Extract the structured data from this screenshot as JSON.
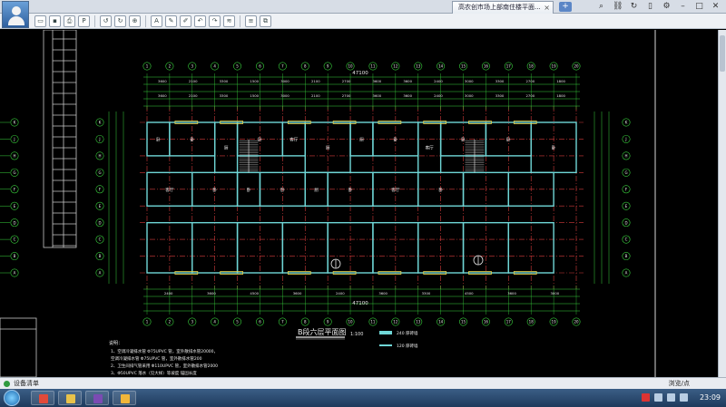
{
  "window": {
    "tab_title": "高农创市场上部南住楼平面...",
    "tab_close": "×",
    "tab_add": "+"
  },
  "toolbar": {
    "icons": [
      "open-icon",
      "save-icon",
      "print-icon",
      "pdf-icon",
      "refresh-icon",
      "rotate-icon",
      "zoom-icon",
      "text-icon",
      "pen-icon",
      "draw-icon",
      "undo-icon",
      "redo-icon",
      "measure-icon",
      "layers-icon",
      "compare-icon"
    ]
  },
  "drawing": {
    "sheet_title": "B段六层平面图",
    "scale": "1:100",
    "total_width_label": "47100",
    "legend": [
      {
        "label": "240 厚砖墙"
      },
      {
        "label": "120 厚砖墙"
      }
    ],
    "notes_title": "说明：",
    "notes": [
      "1、空调冷凝排水管 Φ75UPVC   管，室外散排水管20000，",
      "   空调冷凝排水管 Φ75UPVC   管，室外散排水管200",
      "2、卫生间排气管采用 Φ110UPVC 管，室外散排水管2000",
      "3、Φ50UPVC  落水（见大样）等坡度  锚固长度"
    ],
    "grid_top": [
      "1",
      "2",
      "3",
      "4",
      "5",
      "6",
      "7",
      "8",
      "9",
      "10",
      "11",
      "12",
      "13",
      "14",
      "15",
      "16",
      "17",
      "18",
      "19",
      "20"
    ],
    "grid_left": [
      "K",
      "J",
      "H",
      "G",
      "F",
      "E",
      "D",
      "C",
      "B",
      "A"
    ],
    "dims_top": [
      "3600",
      "2100",
      "3300",
      "1500",
      "3000",
      "2100",
      "2700",
      "3600",
      "3600",
      "2400",
      "3000",
      "3300",
      "2700",
      "1800"
    ],
    "dims_bottom": [
      "2400",
      "3600",
      "4500",
      "3600",
      "2400",
      "3600",
      "3300",
      "4500",
      "3600",
      "3000"
    ],
    "rooms": [
      "卧",
      "卧",
      "厨",
      "卧",
      "客厅",
      "厨",
      "厨",
      "卧",
      "客厅",
      "卧",
      "卧",
      "卧",
      "客厅",
      "卧",
      "卧",
      "卧",
      "厨",
      "卧",
      "客厅",
      "卧"
    ]
  },
  "status": {
    "left": "设备清单",
    "right": "浏览/点"
  },
  "taskbar": {
    "clock": "23:09"
  },
  "colors": {
    "bg": "#000000",
    "wall": "#6fd6d6",
    "axis": "#d23b3b",
    "dim": "#39d33d",
    "text": "#e8e8e8",
    "window": "#e8d44a"
  }
}
